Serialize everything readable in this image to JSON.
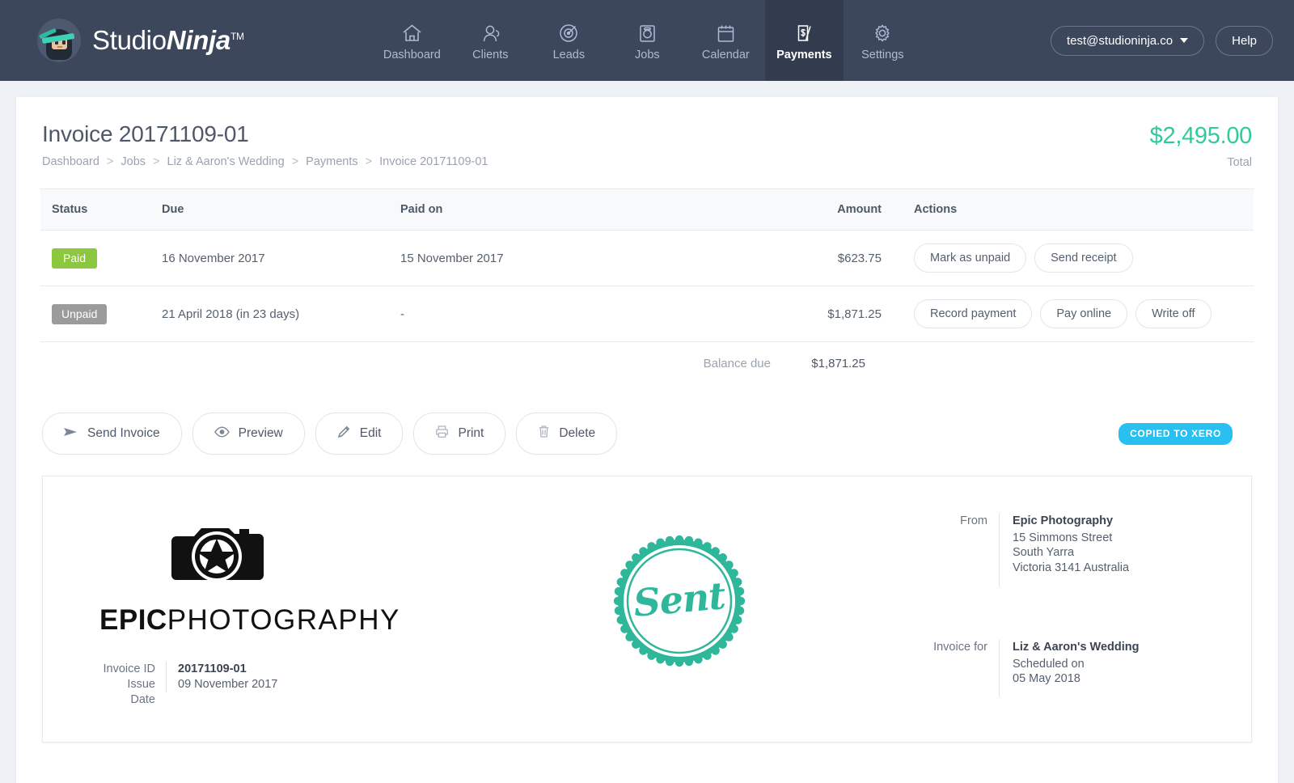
{
  "header": {
    "brand": {
      "part1": "Studio",
      "part2": "Ninja",
      "tm": "TM",
      "logo_icon": "ninja-avatar-icon"
    },
    "nav": [
      {
        "label": "Dashboard",
        "icon": "home-icon",
        "active": false
      },
      {
        "label": "Clients",
        "icon": "people-icon",
        "active": false
      },
      {
        "label": "Leads",
        "icon": "target-icon",
        "active": false
      },
      {
        "label": "Jobs",
        "icon": "camera-icon",
        "active": false
      },
      {
        "label": "Calendar",
        "icon": "calendar-icon",
        "active": false
      },
      {
        "label": "Payments",
        "icon": "invoice-dollar-icon",
        "active": true
      },
      {
        "label": "Settings",
        "icon": "gear-icon",
        "active": false
      }
    ],
    "account_email": "test@studioninja.co",
    "help_label": "Help"
  },
  "page": {
    "title": "Invoice 20171109-01",
    "breadcrumb": [
      "Dashboard",
      "Jobs",
      "Liz & Aaron's Wedding",
      "Payments",
      "Invoice 20171109-01"
    ],
    "breadcrumb_separator": ">",
    "total_amount": "$2,495.00",
    "total_label": "Total",
    "total_color": "#2ecc9b"
  },
  "payments_table": {
    "columns": [
      "Status",
      "Due",
      "Paid on",
      "Amount",
      "Actions"
    ],
    "rows": [
      {
        "status": "Paid",
        "status_color": "#8dc63f",
        "due": "16 November 2017",
        "paid_on": "15 November 2017",
        "amount": "$623.75",
        "actions": [
          "Mark as unpaid",
          "Send receipt"
        ]
      },
      {
        "status": "Unpaid",
        "status_color": "#9b9b9b",
        "due": "21 April 2018 (in 23 days)",
        "paid_on": "-",
        "amount": "$1,871.25",
        "actions": [
          "Record payment",
          "Pay online",
          "Write off"
        ]
      }
    ],
    "balance_label": "Balance due",
    "balance_value": "$1,871.25"
  },
  "actionbar": {
    "buttons": [
      {
        "label": "Send Invoice",
        "icon": "send-arrow-icon"
      },
      {
        "label": "Preview",
        "icon": "eye-icon"
      },
      {
        "label": "Edit",
        "icon": "pencil-icon"
      },
      {
        "label": "Print",
        "icon": "printer-icon"
      },
      {
        "label": "Delete",
        "icon": "trash-icon"
      }
    ],
    "xero_badge": "COPIED TO XERO",
    "xero_badge_color": "#27c0f0"
  },
  "invoice_preview": {
    "logo": {
      "icon": "camera-star-logo-icon",
      "word_bold": "EPIC",
      "word_thin": "PHOTOGRAPHY"
    },
    "stamp": {
      "text": "Sent",
      "color": "#2eb79b"
    },
    "meta": [
      {
        "key": "Invoice ID",
        "value": "20171109-01",
        "strong": true
      },
      {
        "key": "Issue Date",
        "value": "09 November 2017",
        "strong": false
      }
    ],
    "from": {
      "key": "From",
      "name": "Epic Photography",
      "lines": [
        "15 Simmons Street",
        "South Yarra",
        "Victoria 3141 Australia"
      ]
    },
    "invoice_for": {
      "key": "Invoice for",
      "name": "Liz & Aaron's Wedding",
      "lines": [
        "Scheduled on",
        "05 May 2018"
      ]
    }
  }
}
